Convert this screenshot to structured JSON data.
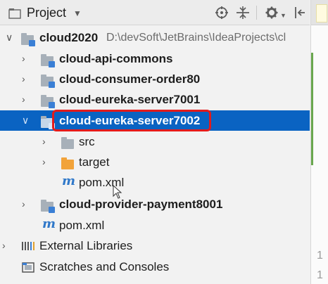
{
  "header": {
    "title": "Project",
    "dropdown_glyph": "▼",
    "icons": [
      "folder-icon",
      "locate-icon",
      "collapse-all-icon",
      "gear-icon",
      "hide-icon"
    ]
  },
  "tree": [
    {
      "label": "cloud2020",
      "path": "D:\\devSoft\\JetBrains\\IdeaProjects\\cl",
      "expanded": true,
      "type": "module"
    },
    {
      "label": "cloud-api-commons",
      "expanded": false,
      "type": "module"
    },
    {
      "label": "cloud-consumer-order80",
      "expanded": false,
      "type": "module"
    },
    {
      "label": "cloud-eureka-server7001",
      "expanded": false,
      "type": "module"
    },
    {
      "label": "cloud-eureka-server7002",
      "expanded": true,
      "type": "module",
      "selected": true
    },
    {
      "label": "src",
      "expanded": false,
      "type": "folder"
    },
    {
      "label": "target",
      "expanded": false,
      "type": "excluded-folder"
    },
    {
      "label": "pom.xml",
      "type": "maven"
    },
    {
      "label": "cloud-provider-payment8001",
      "expanded": false,
      "type": "module"
    },
    {
      "label": "pom.xml",
      "type": "maven"
    },
    {
      "label": "External Libraries",
      "expanded": false,
      "type": "libraries"
    },
    {
      "label": "Scratches and Consoles",
      "type": "scratches"
    }
  ],
  "gutter": {
    "line_numbers": [
      "1",
      "1"
    ]
  },
  "colors": {
    "selection": "#0a63c2",
    "callout": "#e31b1b",
    "folder": "#a7b0b9",
    "target_folder": "#f2a33a",
    "maven": "#2f78c9"
  }
}
